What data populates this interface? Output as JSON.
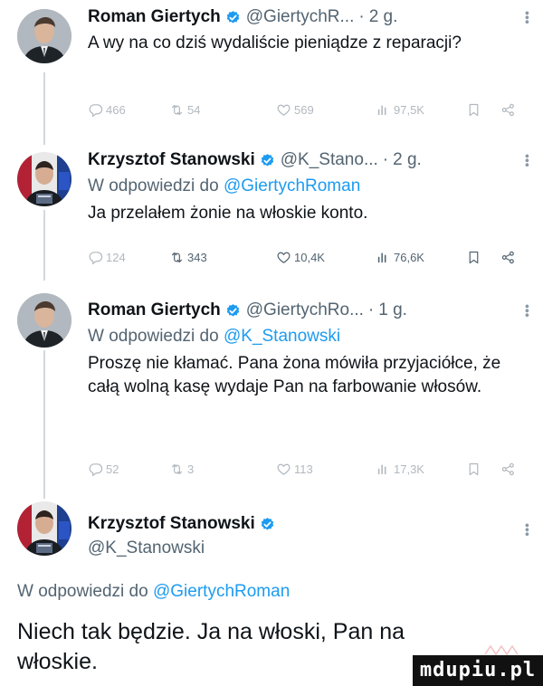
{
  "tweets": [
    {
      "name": "Roman Giertych",
      "handle": "@GiertychR...",
      "time": "2 g.",
      "text": "A wy na co dziś wydaliście pieniądze z reparacji?",
      "stats": {
        "replies": "466",
        "retweets": "54",
        "likes": "569",
        "views": "97,5K"
      }
    },
    {
      "name": "Krzysztof Stanowski",
      "handle": "@K_Stano...",
      "time": "2 g.",
      "reply_prefix": "W odpowiedzi do",
      "reply_to": "@GiertychRoman",
      "text": "Ja przelałem żonie na włoskie konto.",
      "stats": {
        "replies": "124",
        "retweets": "343",
        "likes": "10,4K",
        "views": "76,6K"
      }
    },
    {
      "name": "Roman Giertych",
      "handle": "@GiertychRo...",
      "time": "1 g.",
      "reply_prefix": "W odpowiedzi do",
      "reply_to": "@K_Stanowski",
      "text": "Proszę nie kłamać. Pana żona mówiła przyjaciółce, że całą wolną kasę wydaje Pan na farbowanie włosów.",
      "stats": {
        "replies": "52",
        "retweets": "3",
        "likes": "113",
        "views": "17,3K"
      }
    },
    {
      "name": "Krzysztof Stanowski",
      "handle": "@K_Stanowski",
      "reply_prefix": "W odpowiedzi do",
      "reply_to": "@GiertychRoman",
      "text": "Niech tak będzie. Ja na włoski, Pan na włoskie."
    }
  ],
  "watermark": "mdupiu.pl",
  "colors": {
    "accent": "#1d9bf0",
    "muted": "#536471",
    "text": "#0f1419",
    "line": "#cfd9de"
  },
  "icons": [
    "reply-icon",
    "retweet-icon",
    "like-icon",
    "views-icon",
    "bookmark-icon",
    "share-icon",
    "verified-icon",
    "more-icon"
  ]
}
